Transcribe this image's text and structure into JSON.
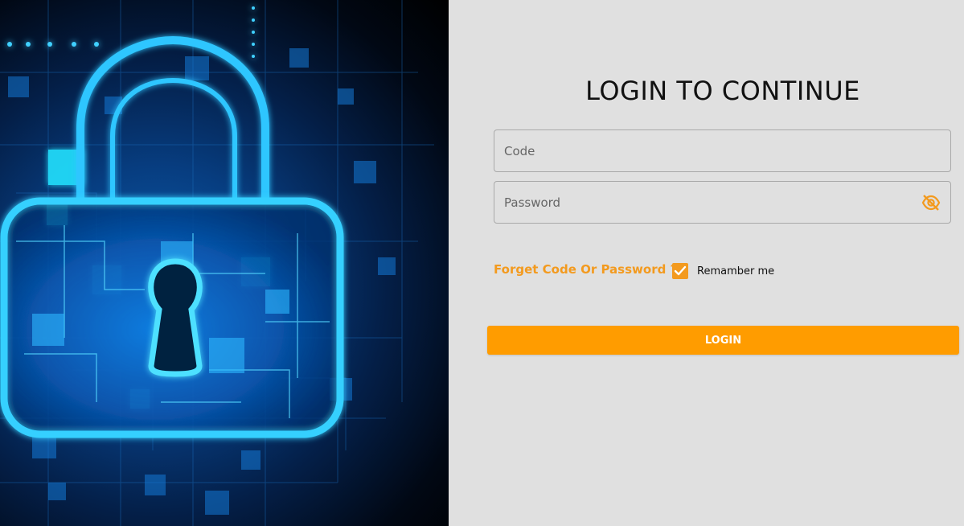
{
  "login": {
    "title": "LOGIN TO CONTINUE",
    "code_placeholder": "Code",
    "password_placeholder": "Password",
    "forget_link": "Forget Code Or Password ??",
    "remember_label": "Remamber me",
    "remember_checked": true,
    "login_button": "LOGIN",
    "password_toggle_icon": "eye-off-icon"
  },
  "hero": {
    "image_subject": "padlock-cybersecurity-illustration"
  },
  "colors": {
    "accent": "#ff9c00",
    "link": "#f39a1e",
    "panel_background": "#e0e0e0",
    "hero_glow": "#29c8ff"
  }
}
